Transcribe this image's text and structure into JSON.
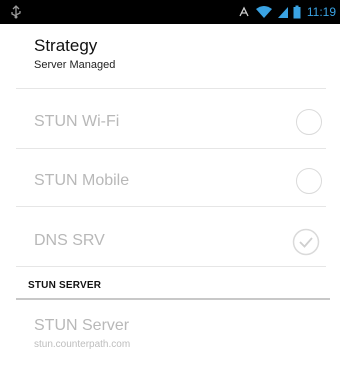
{
  "status_bar": {
    "time": "11:19",
    "icons": [
      "usb-debug-icon",
      "signal-boost-icon",
      "wifi-icon",
      "cell-signal-icon",
      "battery-icon"
    ]
  },
  "strategy": {
    "title": "Strategy",
    "value": "Server Managed"
  },
  "options": [
    {
      "label": "STUN Wi-Fi",
      "checked": false
    },
    {
      "label": "STUN Mobile",
      "checked": false
    },
    {
      "label": "DNS SRV",
      "checked": true
    }
  ],
  "stun_section": {
    "header": "STUN SERVER",
    "server_title": "STUN Server",
    "server_value": "stun.counterpath.com"
  },
  "colors": {
    "status_bar_bg": "#000000",
    "accent": "#3aa3e3",
    "disabled_text": "#b8b8b8"
  }
}
